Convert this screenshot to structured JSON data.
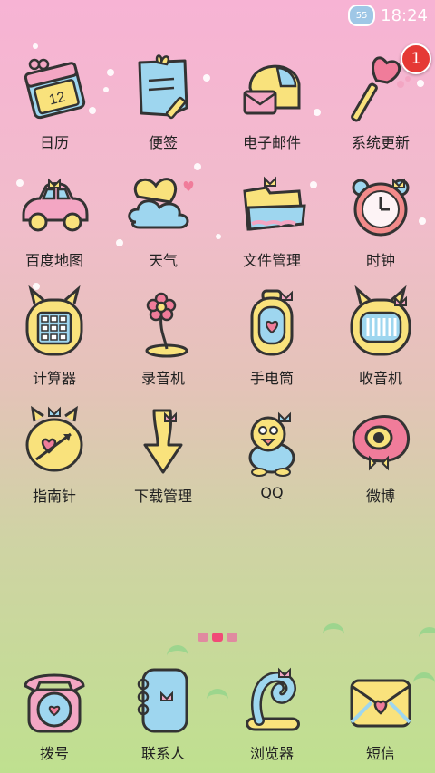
{
  "status_bar": {
    "time": "18:24",
    "weather_badge": "55",
    "weather_icon": "cloud-sun-icon"
  },
  "apps": [
    {
      "label": "日历",
      "icon": "calendar-icon",
      "calendar_day": "12"
    },
    {
      "label": "便签",
      "icon": "notepad-icon"
    },
    {
      "label": "电子邮件",
      "icon": "mail-icon"
    },
    {
      "label": "系统更新",
      "icon": "heart-wand-icon",
      "badge": "1"
    },
    {
      "label": "百度地图",
      "icon": "car-icon"
    },
    {
      "label": "天气",
      "icon": "cloud-heart-icon"
    },
    {
      "label": "文件管理",
      "icon": "folder-icon"
    },
    {
      "label": "时钟",
      "icon": "alarm-clock-icon"
    },
    {
      "label": "计算器",
      "icon": "calculator-icon"
    },
    {
      "label": "录音机",
      "icon": "flower-microphone-icon"
    },
    {
      "label": "手电筒",
      "icon": "lantern-icon"
    },
    {
      "label": "收音机",
      "icon": "radio-icon"
    },
    {
      "label": "指南针",
      "icon": "compass-icon"
    },
    {
      "label": "下载管理",
      "icon": "download-arrow-icon"
    },
    {
      "label": "QQ",
      "icon": "penguin-icon"
    },
    {
      "label": "微博",
      "icon": "weibo-eye-icon"
    }
  ],
  "dock": [
    {
      "label": "拨号",
      "icon": "rotary-phone-icon"
    },
    {
      "label": "联系人",
      "icon": "contacts-book-icon"
    },
    {
      "label": "浏览器",
      "icon": "swan-browser-icon"
    },
    {
      "label": "短信",
      "icon": "envelope-heart-icon"
    }
  ],
  "colors": {
    "pink": "#f3a6c3",
    "yellow": "#f9e27c",
    "blue": "#9ed6ef",
    "outline": "#333333",
    "badge_red": "#e53935"
  }
}
